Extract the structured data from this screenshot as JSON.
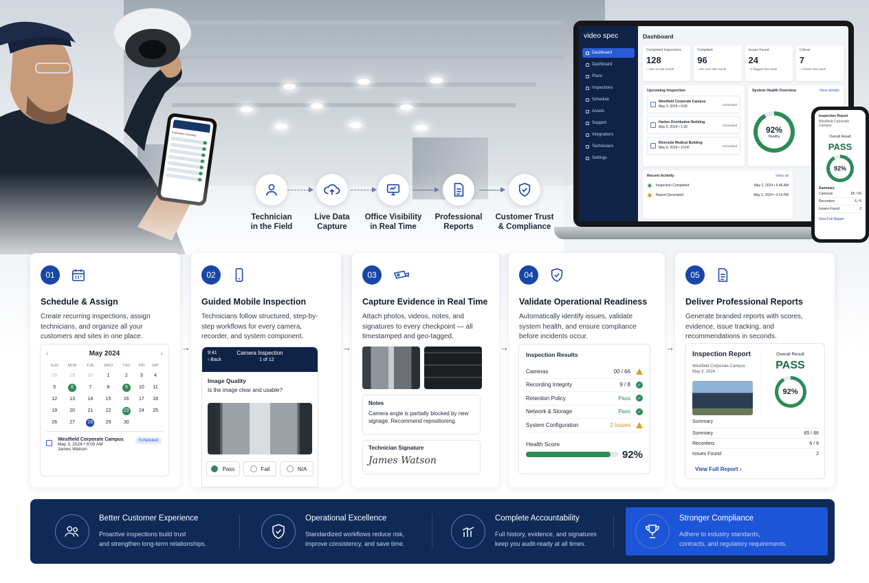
{
  "flow": [
    {
      "label": "Technician\nin the Field",
      "icon": "user-icon"
    },
    {
      "label": "Live Data\nCapture",
      "icon": "cloud-upload-icon"
    },
    {
      "label": "Office Visibility\nin Real Time",
      "icon": "monitor-icon"
    },
    {
      "label": "Professional\nReports",
      "icon": "document-icon"
    },
    {
      "label": "Customer Trust\n& Compliance",
      "icon": "shield-check-icon"
    }
  ],
  "laptop": {
    "brand": "video spec",
    "title": "Dashboard",
    "nav": [
      "Dashboard",
      "Dashboard",
      "Plans",
      "Inspections",
      "Schedule",
      "Assets",
      "Support",
      "Integrations",
      "Technicians",
      "Settings"
    ],
    "stats": [
      {
        "label": "Completed Inspections",
        "value": "128",
        "sub": "↑ 18% vs last month"
      },
      {
        "label": "Compliant",
        "value": "96",
        "sub": "↑ 6% over last month"
      },
      {
        "label": "Issues Found",
        "value": "24",
        "sub": "↑ 5 flagged this week"
      },
      {
        "label": "Critical",
        "value": "7",
        "sub": "↓ 2 fewer this week"
      }
    ],
    "upcoming_title": "Upcoming Inspection",
    "upcoming": [
      {
        "name": "Westfield Corporate Campus",
        "meta": "May 3, 2024 • 9:00",
        "status": "Scheduled"
      },
      {
        "name": "Harbor Distribution Building",
        "meta": "May 6, 2024 • 1:30",
        "status": "Scheduled"
      },
      {
        "name": "Riverside Medical Building",
        "meta": "May 8, 2024 • 10:00",
        "status": "Scheduled"
      }
    ],
    "health_title": "System Health Overview",
    "health_link": "View details",
    "health_value": "92%",
    "health_label": "Healthy",
    "recent_title": "Recent Activity",
    "recent_link": "View all",
    "recent": [
      {
        "text": "Inspection Completed",
        "time": "May 2, 2024 • 5:46 AM"
      },
      {
        "text": "Report Generated",
        "time": "May 2, 2024 • 2:14 PM"
      }
    ]
  },
  "sphone": {
    "title": "Inspection Report",
    "sub": "Westfield Corporate Campus",
    "overall": "Overall Result",
    "pass": "PASS",
    "score": "92%",
    "summary": "Summary",
    "rows": [
      [
        "Cameras",
        "65 / 66"
      ],
      [
        "Recorders",
        "6 / 6"
      ],
      [
        "Issues Found",
        "2"
      ]
    ],
    "footer": "View Full Report"
  },
  "handphone": {
    "title": "Inspection Checklist"
  },
  "cards": [
    {
      "num": "01",
      "icon": "calendar-icon",
      "title": "Schedule & Assign",
      "desc": "Create recurring inspections, assign technicians, and organize all your customers and sites in one place."
    },
    {
      "num": "02",
      "icon": "smartphone-icon",
      "title": "Guided Mobile Inspection",
      "desc": "Technicians follow structured, step-by-step workflows for every camera, recorder, and system component."
    },
    {
      "num": "03",
      "icon": "camera-icon",
      "title": "Capture Evidence in Real Time",
      "desc": "Attach photos, videos, notes, and signatures to every checkpoint — all timestamped and geo-tagged."
    },
    {
      "num": "04",
      "icon": "shield-check-icon",
      "title": "Validate Operational Readiness",
      "desc": "Automatically identify issues, validate system health, and ensure compliance before incidents occur."
    },
    {
      "num": "05",
      "icon": "document-icon",
      "title": "Deliver Professional Reports",
      "desc": "Generate branded reports with scores, evidence, issue tracking, and recommendations in seconds."
    }
  ],
  "calendar": {
    "month": "May 2024",
    "prev": "‹",
    "next": "›",
    "days": [
      "SUN",
      "MON",
      "TUE",
      "WED",
      "THU",
      "FRI",
      "SAT"
    ],
    "weeks": [
      [
        "28",
        "29",
        "30",
        "1",
        "2",
        "3",
        "4"
      ],
      [
        "5",
        "6",
        "7",
        "8",
        "9",
        "10",
        "11"
      ],
      [
        "12",
        "13",
        "14",
        "15",
        "16",
        "17",
        "18"
      ],
      [
        "19",
        "20",
        "21",
        "22",
        "23",
        "24",
        "25"
      ],
      [
        "26",
        "27",
        "28",
        "29",
        "30",
        "",
        ""
      ]
    ],
    "event_title": "Westfield Corporate Campus",
    "event_meta": "May 3, 2024 • 9:00 AM",
    "event_tech": "James Watson",
    "event_tag": "Scheduled"
  },
  "mobile": {
    "time": "9:41",
    "back": "‹ Back",
    "title": "Camera Inspection",
    "step": "1 of 12",
    "question_title": "Image Quality",
    "question": "Is the image clear and usable?",
    "options": [
      "Pass",
      "Fail",
      "N/A"
    ]
  },
  "evidence": {
    "notes_title": "Notes",
    "notes": "Camera angle is partially blocked by new signage. Recommend repositioning.",
    "sig_title": "Technician Signature",
    "sig_text": "James Watson"
  },
  "results": {
    "title": "Inspection Results",
    "rows": [
      {
        "label": "Cameras",
        "value": "00 / 66",
        "status": "warn"
      },
      {
        "label": "Recording Integrity",
        "value": "9 / 8",
        "status": "ok"
      },
      {
        "label": "Retention Policy",
        "value": "Pass",
        "status": "ok"
      },
      {
        "label": "Network & Storage",
        "value": "Pass",
        "status": "ok"
      },
      {
        "label": "System Configuration",
        "value": "2 Issues",
        "status": "warn"
      }
    ],
    "health_label": "Health Score",
    "health_value": "92%",
    "health_fraction": 0.92
  },
  "report": {
    "title": "Inspection Report",
    "site": "Westfield Corporate Campus",
    "meta": "May 3, 2024",
    "overall": "Overall Result",
    "pass": "PASS",
    "score": "92%",
    "summary": "Summary",
    "rows": [
      [
        "Summary",
        "65 / 66"
      ],
      [
        "Recorders",
        "6 / 6"
      ],
      [
        "Issues Found",
        "2"
      ]
    ],
    "link": "View Full Report ›"
  },
  "benefits": [
    {
      "icon": "users-icon",
      "title": "Better Customer Experience",
      "desc": "Proactive inspections build trust\nand strengthen long-term relationships."
    },
    {
      "icon": "shield-check-icon",
      "title": "Operational Excellence",
      "desc": "Standardized workflows reduce risk,\nimprove consistency, and save time."
    },
    {
      "icon": "bar-chart-icon",
      "title": "Complete Accountability",
      "desc": "Full history, evidence, and signatures\nkeep you audit-ready at all times."
    },
    {
      "icon": "trophy-icon",
      "title": "Stronger Compliance",
      "desc": "Adhere to industry standards,\ncontracts, and regulatory requirements."
    }
  ],
  "colors": {
    "navy": "#0f2a57",
    "accent": "#1847a8",
    "green": "#2e8a56",
    "warning": "#e39a2b"
  }
}
